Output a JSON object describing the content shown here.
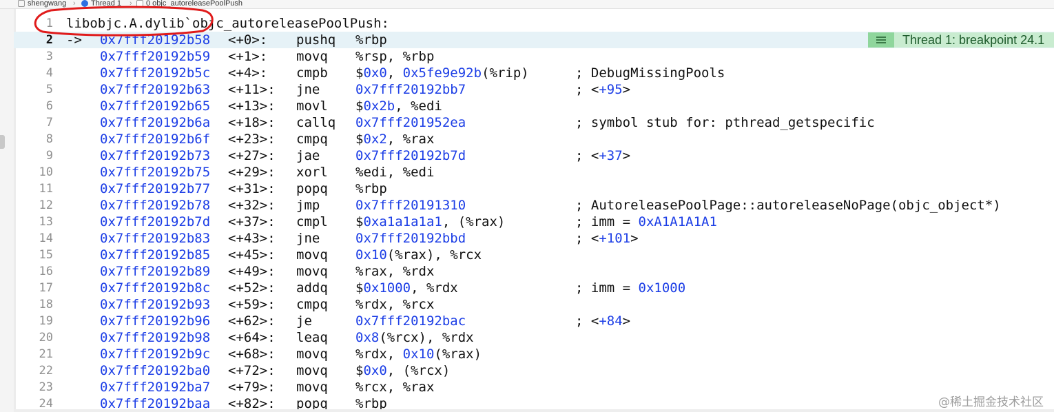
{
  "breadcrumb": {
    "project": "shengwang",
    "thread": "Thread 1",
    "frame": "0 objc_autoreleasePoolPush"
  },
  "editor": {
    "header": {
      "line_number": "1",
      "text": "libobjc.A.dylib`objc_autoreleasePoolPush:"
    },
    "pc_marker": "->",
    "current_line": 2,
    "rows": [
      {
        "n": "2",
        "addr": "0x7fff20192b58",
        "off": "<+0>:",
        "mn": "pushq",
        "ops": [
          {
            "t": "%rbp"
          }
        ],
        "cm": []
      },
      {
        "n": "3",
        "addr": "0x7fff20192b59",
        "off": "<+1>:",
        "mn": "movq",
        "ops": [
          {
            "t": "%rsp, %rbp"
          }
        ],
        "cm": []
      },
      {
        "n": "4",
        "addr": "0x7fff20192b5c",
        "off": "<+4>:",
        "mn": "cmpb",
        "ops": [
          {
            "t": "$"
          },
          {
            "t": "0x0",
            "b": true
          },
          {
            "t": ", "
          },
          {
            "t": "0x5fe9e92b",
            "b": true
          },
          {
            "t": "(%rip)"
          }
        ],
        "cm": [
          {
            "t": "; DebugMissingPools"
          }
        ]
      },
      {
        "n": "5",
        "addr": "0x7fff20192b63",
        "off": "<+11>:",
        "mn": "jne",
        "ops": [
          {
            "t": "0x7fff20192bb7",
            "b": true
          }
        ],
        "cm": [
          {
            "t": "; <"
          },
          {
            "t": "+95",
            "b": true
          },
          {
            "t": ">"
          }
        ]
      },
      {
        "n": "6",
        "addr": "0x7fff20192b65",
        "off": "<+13>:",
        "mn": "movl",
        "ops": [
          {
            "t": "$"
          },
          {
            "t": "0x2b",
            "b": true
          },
          {
            "t": ", %edi"
          }
        ],
        "cm": []
      },
      {
        "n": "7",
        "addr": "0x7fff20192b6a",
        "off": "<+18>:",
        "mn": "callq",
        "ops": [
          {
            "t": "0x7fff201952ea",
            "b": true
          }
        ],
        "cm": [
          {
            "t": "; symbol stub for: pthread_getspecific"
          }
        ]
      },
      {
        "n": "8",
        "addr": "0x7fff20192b6f",
        "off": "<+23>:",
        "mn": "cmpq",
        "ops": [
          {
            "t": "$"
          },
          {
            "t": "0x2",
            "b": true
          },
          {
            "t": ", %rax"
          }
        ],
        "cm": []
      },
      {
        "n": "9",
        "addr": "0x7fff20192b73",
        "off": "<+27>:",
        "mn": "jae",
        "ops": [
          {
            "t": "0x7fff20192b7d",
            "b": true
          }
        ],
        "cm": [
          {
            "t": "; <"
          },
          {
            "t": "+37",
            "b": true
          },
          {
            "t": ">"
          }
        ]
      },
      {
        "n": "10",
        "addr": "0x7fff20192b75",
        "off": "<+29>:",
        "mn": "xorl",
        "ops": [
          {
            "t": "%edi, %edi"
          }
        ],
        "cm": []
      },
      {
        "n": "11",
        "addr": "0x7fff20192b77",
        "off": "<+31>:",
        "mn": "popq",
        "ops": [
          {
            "t": "%rbp"
          }
        ],
        "cm": []
      },
      {
        "n": "12",
        "addr": "0x7fff20192b78",
        "off": "<+32>:",
        "mn": "jmp",
        "ops": [
          {
            "t": "0x7fff20191310",
            "b": true
          }
        ],
        "cm": [
          {
            "t": "; AutoreleasePoolPage::autoreleaseNoPage(objc_object*)"
          }
        ]
      },
      {
        "n": "13",
        "addr": "0x7fff20192b7d",
        "off": "<+37>:",
        "mn": "cmpl",
        "ops": [
          {
            "t": "$"
          },
          {
            "t": "0xa1a1a1a1",
            "b": true
          },
          {
            "t": ", (%rax)"
          }
        ],
        "cm": [
          {
            "t": "; imm = "
          },
          {
            "t": "0xA1A1A1A1",
            "b": true
          }
        ]
      },
      {
        "n": "14",
        "addr": "0x7fff20192b83",
        "off": "<+43>:",
        "mn": "jne",
        "ops": [
          {
            "t": "0x7fff20192bbd",
            "b": true
          }
        ],
        "cm": [
          {
            "t": "; <"
          },
          {
            "t": "+101",
            "b": true
          },
          {
            "t": ">"
          }
        ]
      },
      {
        "n": "15",
        "addr": "0x7fff20192b85",
        "off": "<+45>:",
        "mn": "movq",
        "ops": [
          {
            "t": "0x10",
            "b": true
          },
          {
            "t": "(%rax), %rcx"
          }
        ],
        "cm": []
      },
      {
        "n": "16",
        "addr": "0x7fff20192b89",
        "off": "<+49>:",
        "mn": "movq",
        "ops": [
          {
            "t": "%rax, %rdx"
          }
        ],
        "cm": []
      },
      {
        "n": "17",
        "addr": "0x7fff20192b8c",
        "off": "<+52>:",
        "mn": "addq",
        "ops": [
          {
            "t": "$"
          },
          {
            "t": "0x1000",
            "b": true
          },
          {
            "t": ", %rdx"
          }
        ],
        "cm": [
          {
            "t": "; imm = "
          },
          {
            "t": "0x1000",
            "b": true
          }
        ]
      },
      {
        "n": "18",
        "addr": "0x7fff20192b93",
        "off": "<+59>:",
        "mn": "cmpq",
        "ops": [
          {
            "t": "%rdx, %rcx"
          }
        ],
        "cm": []
      },
      {
        "n": "19",
        "addr": "0x7fff20192b96",
        "off": "<+62>:",
        "mn": "je",
        "ops": [
          {
            "t": "0x7fff20192bac",
            "b": true
          }
        ],
        "cm": [
          {
            "t": "; <"
          },
          {
            "t": "+84",
            "b": true
          },
          {
            "t": ">"
          }
        ]
      },
      {
        "n": "20",
        "addr": "0x7fff20192b98",
        "off": "<+64>:",
        "mn": "leaq",
        "ops": [
          {
            "t": "0x8",
            "b": true
          },
          {
            "t": "(%rcx), %rdx"
          }
        ],
        "cm": []
      },
      {
        "n": "21",
        "addr": "0x7fff20192b9c",
        "off": "<+68>:",
        "mn": "movq",
        "ops": [
          {
            "t": "%rdx, "
          },
          {
            "t": "0x10",
            "b": true
          },
          {
            "t": "(%rax)"
          }
        ],
        "cm": []
      },
      {
        "n": "22",
        "addr": "0x7fff20192ba0",
        "off": "<+72>:",
        "mn": "movq",
        "ops": [
          {
            "t": "$"
          },
          {
            "t": "0x0",
            "b": true
          },
          {
            "t": ", (%rcx)"
          }
        ],
        "cm": []
      },
      {
        "n": "23",
        "addr": "0x7fff20192ba7",
        "off": "<+79>:",
        "mn": "movq",
        "ops": [
          {
            "t": "%rcx, %rax"
          }
        ],
        "cm": []
      },
      {
        "n": "24",
        "addr": "0x7fff20192baa",
        "off": "<+82>:",
        "mn": "popq",
        "ops": [
          {
            "t": "%rbp"
          }
        ],
        "cm": []
      }
    ]
  },
  "breakpoint": {
    "label": "Thread 1: breakpoint 24.1",
    "color": "#8fd69c"
  },
  "watermark": "@稀土掘金技术社区",
  "colors": {
    "address": "#1c3ee6",
    "current_line_bg": "#e6f2f7",
    "annotation_circle": "#e01b1b"
  }
}
